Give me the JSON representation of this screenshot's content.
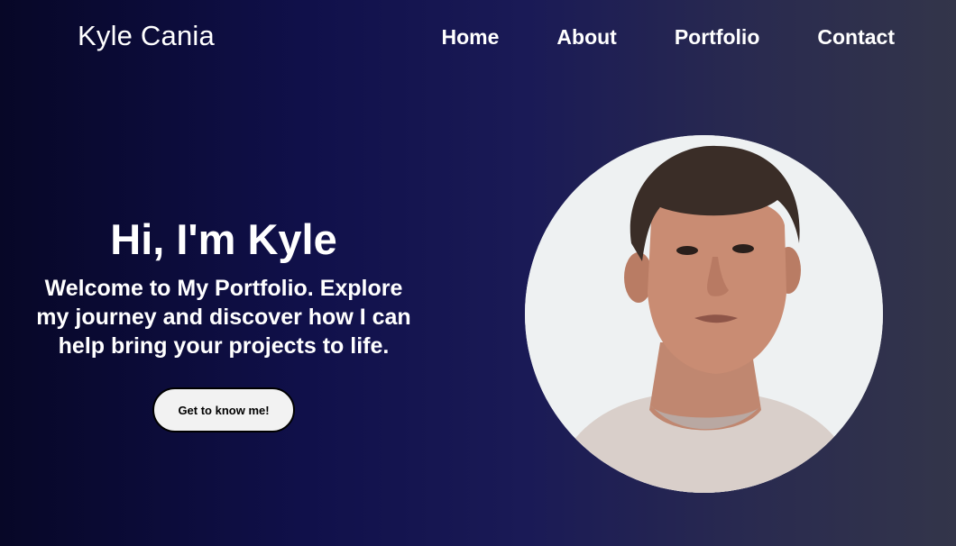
{
  "header": {
    "brand": "Kyle Cania",
    "nav": [
      {
        "label": "Home"
      },
      {
        "label": "About"
      },
      {
        "label": "Portfolio"
      },
      {
        "label": "Contact"
      }
    ]
  },
  "hero": {
    "title": "Hi, I'm Kyle",
    "subtitle": "Welcome to My Portfolio. Explore my journey and discover how I can help bring your projects to life.",
    "cta_label": "Get to know me!"
  },
  "colors": {
    "background_start": "#070727",
    "background_end": "#33354a",
    "text": "#ffffff",
    "button_bg": "#f2f2f2"
  }
}
